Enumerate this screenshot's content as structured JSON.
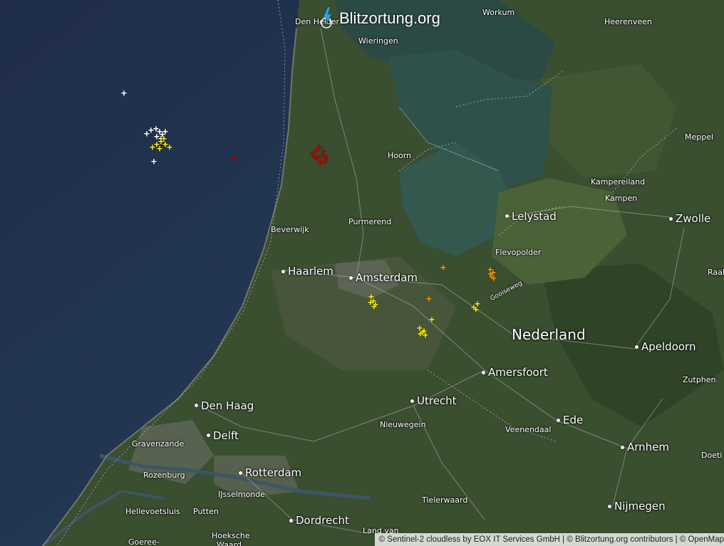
{
  "brand": {
    "title": "Blitzortung.org",
    "icon": "lightning-bolt-icon"
  },
  "country_label": "Nederland",
  "places": {
    "den_helder": "Den Helder",
    "workum": "Workum",
    "heerenveen": "Heerenveen",
    "wieringen": "Wieringen",
    "meppel": "Meppel",
    "hoorn": "Hoorn",
    "kampereiland": "Kampereiland",
    "kampen": "Kampen",
    "lelystad": "Lelystad",
    "zwolle": "Zwolle",
    "beverwijk": "Beverwijk",
    "purmerend": "Purmerend",
    "flevopolder": "Flevopolder",
    "raalte": "Raalte",
    "haarlem": "Haarlem",
    "amsterdam": "Amsterdam",
    "gooiseweg": "Gooiseweg",
    "apeldoorn": "Apeldoorn",
    "amersfoort": "Amersfoort",
    "zutphen": "Zutphen",
    "den_haag": "Den Haag",
    "utrecht": "Utrecht",
    "ede": "Ede",
    "delft": "Delft",
    "nieuwegein": "Nieuwegein",
    "veenendaal": "Veenendaal",
    "gravenzande": "Gravenzande",
    "arnhem": "Arnhem",
    "doetinchem": "Doeti",
    "rozenburg": "Rozenburg",
    "rotterdam": "Rotterdam",
    "ijsselmonde": "IJsselmonde",
    "hellevoetsluis": "Hellevoetsluis",
    "putten": "Putten",
    "tielerwaard": "Tielerwaard",
    "nijmegen": "Nijmegen",
    "dordrecht": "Dordrecht",
    "land_van": "Land van",
    "hoeksche": "Hoeksche",
    "waard": "Waard",
    "goeree": "Goeree-"
  },
  "strike_symbol": "+",
  "strike_colors": {
    "recent": "#ffffff",
    "newer": "#ffee00",
    "older": "#ff9a00",
    "oldest": "#c40000"
  },
  "attribution": "© Sentinel-2 cloudless by EOX IT Services GmbH | © Blitzortung.org contributors | © OpenMap"
}
